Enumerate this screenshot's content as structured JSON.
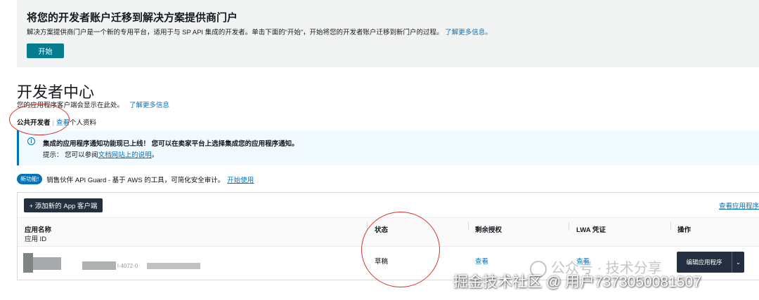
{
  "banner": {
    "title": "将您的开发者账户迁移到解决方案提供商门户",
    "description": "解决方案提供商门户是一个新的专用平台，适用于与 SP API 集成的开发者。单击下面的“开始”，开始将您的开发者账户迁移到新门户的过程。",
    "learn_more": "了解更多信息。",
    "start_button": "开始"
  },
  "page": {
    "title": "开发者中心",
    "subtitle": "您的应用程序客户端会显示在此处。",
    "subtitle_link": "了解更多信息"
  },
  "developer": {
    "type": "公共开发者",
    "separator": "|",
    "view": "查看",
    "profile": "个人资料"
  },
  "notice": {
    "main": "集成的应用程序通知功能现已上线！ 您可以在卖家平台上选择集成您的应用程序通知。",
    "hint_prefix": "提示： 您可以参阅",
    "hint_link": "文档网站上的说明",
    "hint_suffix": "。"
  },
  "new_feature": {
    "badge": "新功能!",
    "text": "销售伙伴 API Guard - 基于 AWS 的工具，可简化安全审计。",
    "link": "开始使用"
  },
  "apps": {
    "add_button": "+ 添加新的 App 客户端",
    "view_link": "查看应用程序和",
    "columns": {
      "name": "应用名称",
      "name_sub": "应用 ID",
      "status": "状态",
      "remaining": "剩余授权",
      "lwa": "LWA 凭证",
      "actions": "操作"
    },
    "rows": [
      {
        "id_fragment": "l-4072-0",
        "status": "草稿",
        "remaining": "查看",
        "lwa": "查看",
        "edit": "编辑应用程序",
        "dropdown": "⌄"
      }
    ]
  },
  "watermark": {
    "wechat": "公众号 · 技术分享",
    "juejin": "掘金技术社区 @ 用户7373050081507"
  },
  "colors": {
    "annotation": "#d9322b",
    "primary": "#067d8f",
    "link": "#0073bb",
    "dark_button": "#232f3e"
  }
}
